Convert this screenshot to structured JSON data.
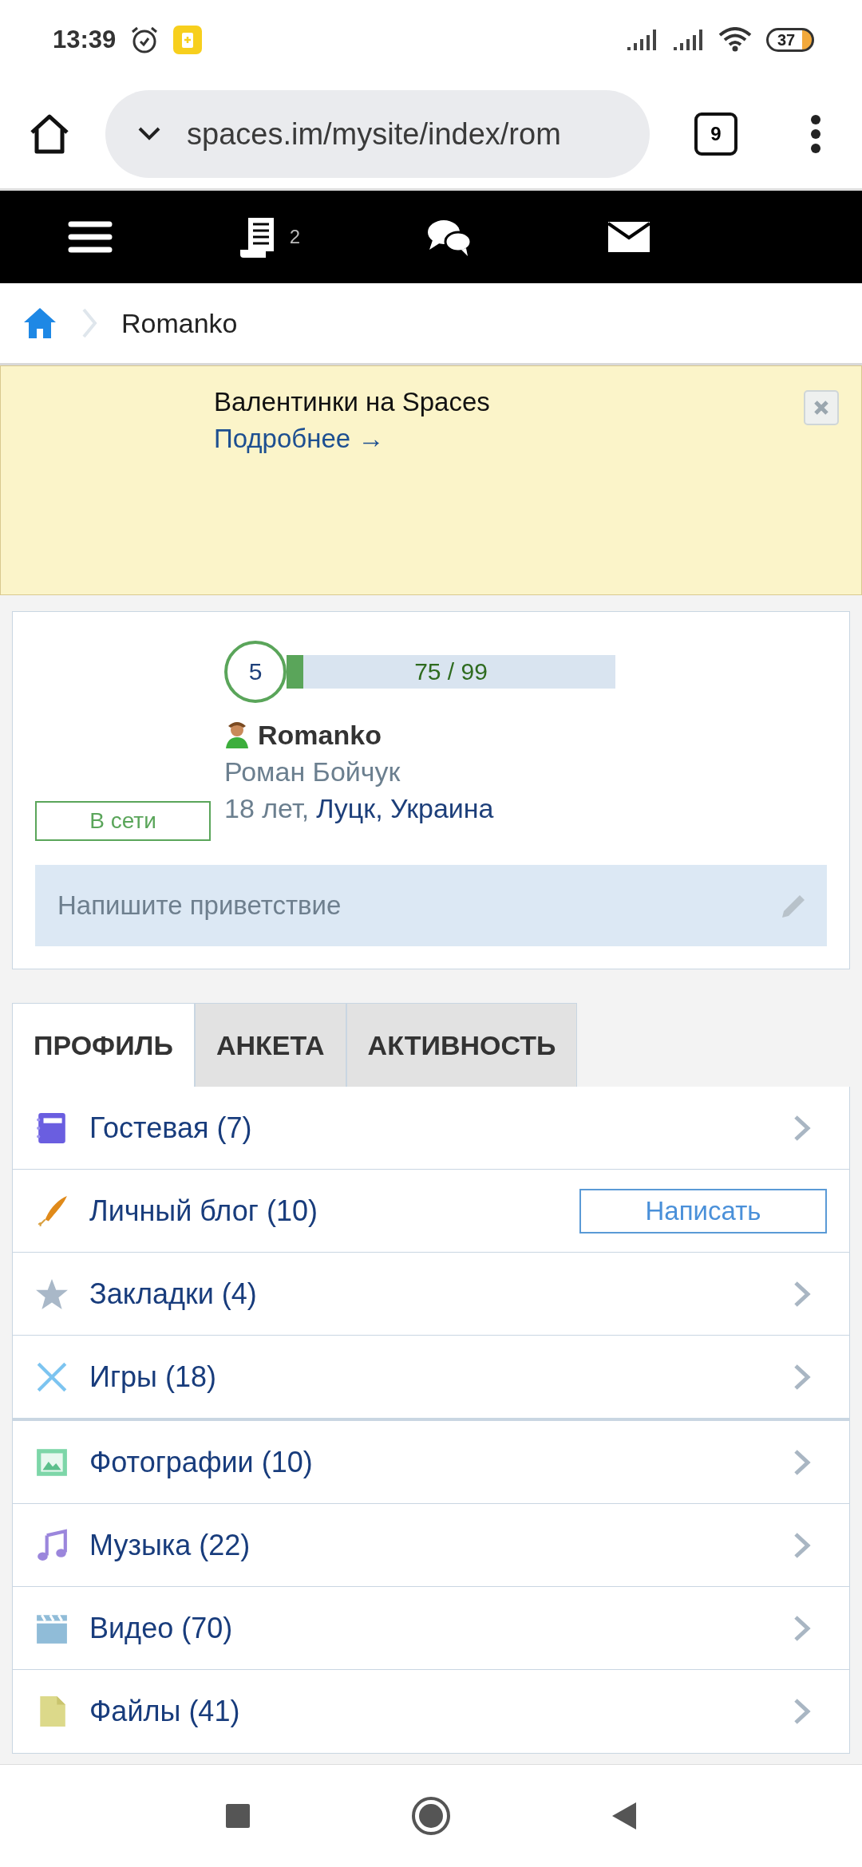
{
  "status_bar": {
    "time": "13:39",
    "battery": "37"
  },
  "browser": {
    "url": "spaces.im/mysite/index/rom",
    "tab_count": "9"
  },
  "nav": {
    "journal_count": "2"
  },
  "breadcrumb": {
    "current": "Romanko"
  },
  "banner": {
    "title": "Валентинки на Spaces",
    "link": "Подробнее →"
  },
  "profile": {
    "level_number": "5",
    "level": 0.05,
    "xp": "75 / 99",
    "username": "Romanko",
    "full_name": "Роман Бойчук",
    "age": "18 лет,",
    "location": "Луцк, Украина",
    "status": "В сети",
    "greeting_placeholder": "Напишите приветствие"
  },
  "tabs": [
    {
      "label": "ПРОФИЛЬ",
      "selected": true
    },
    {
      "label": "АНКЕТА",
      "selected": false
    },
    {
      "label": "АКТИВНОСТЬ",
      "selected": false
    }
  ],
  "menu_sections": [
    {
      "items": [
        {
          "kind": "link",
          "label": "Гостевая (7)"
        },
        {
          "kind": "action",
          "label": "Личный блог (10)",
          "action": "Написать"
        },
        {
          "kind": "link",
          "label": "Закладки (4)"
        },
        {
          "kind": "link",
          "label": "Игры (18)"
        }
      ]
    },
    {
      "items": [
        {
          "kind": "link",
          "label": "Фотографии (10)"
        },
        {
          "kind": "link",
          "label": "Музыка (22)"
        },
        {
          "kind": "link",
          "label": "Видео (70)"
        },
        {
          "kind": "link",
          "label": "Файлы (41)"
        }
      ]
    }
  ]
}
